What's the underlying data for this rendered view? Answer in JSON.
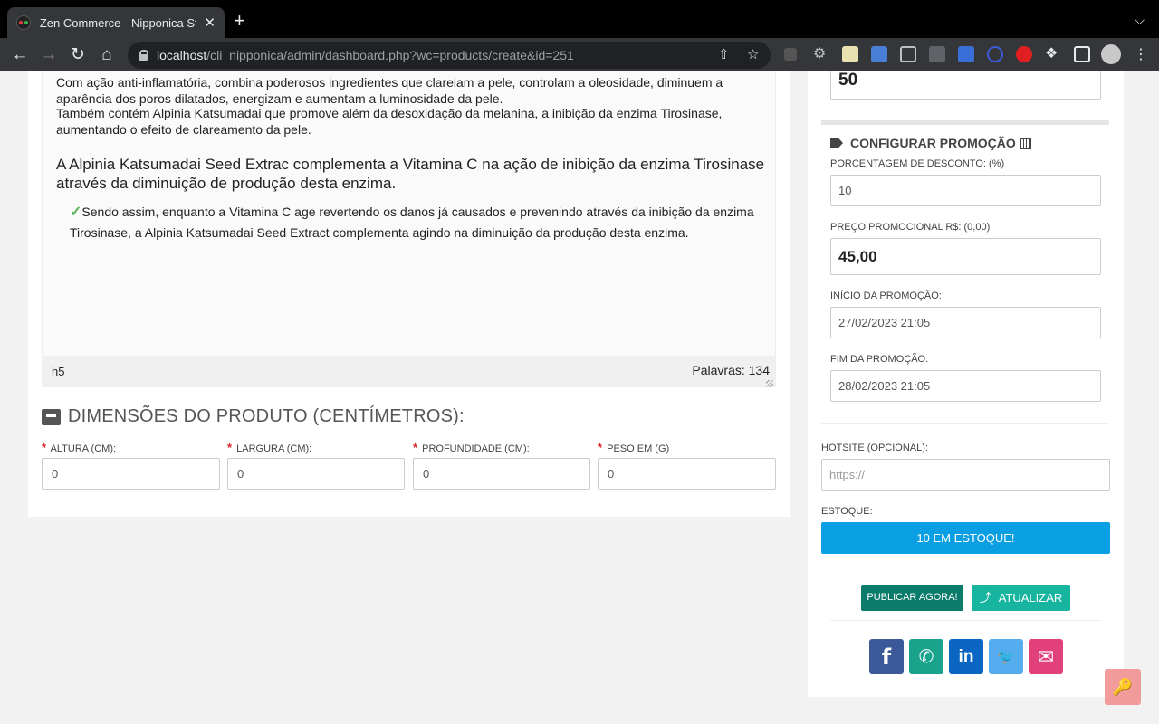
{
  "browser": {
    "tab_title": "Zen Commerce - Nipponica Store",
    "tab_close": "✕",
    "new_tab": "+",
    "url_host": "localhost",
    "url_path": "/cli_nipponica/admin/dashboard.php?wc=products/create&id=251"
  },
  "editor": {
    "paragraph1": "Com ação anti-inflamatória, combina poderosos ingredientes que clareiam a pele, controlam a oleosidade, diminuem a aparência dos poros dilatados, energizam e aumentam a luminosidade da pele.",
    "paragraph2": "Também contém Alpinia Katsumadai que promove além da desoxidação da melanina, a inibição da enzima Tirosinase, aumentando o efeito de clareamento da pele.",
    "heading": "A Alpinia Katsumadai Seed Extrac complementa a Vitamina C na ação de inibição da enzima Tirosinase através da diminuição de produção desta enzima.",
    "check_text": "Sendo assim, enquanto a Vitamina C age revertendo os danos já causados e prevenindo através da inibição da enzima Tirosinase, a Alpinia Katsumadai Seed Extract complementa agindo na diminuição da produção desta enzima.",
    "status_path": "h5",
    "word_count": "Palavras: 134"
  },
  "dimensions": {
    "title": "DIMENSÕES DO PRODUTO (CENTÍMETROS):",
    "height_label": "ALTURA (CM):",
    "height_value": "0",
    "width_label": "LARGURA (CM):",
    "width_value": "0",
    "depth_label": "PROFUNDIDADE (CM):",
    "depth_value": "0",
    "weight_label": "PESO EM (G)",
    "weight_value": "0",
    "required_mark": "*"
  },
  "sidebar": {
    "top_value": "50",
    "promo_title": "CONFIGURAR PROMOÇÃO",
    "discount_label": "PORCENTAGEM DE DESCONTO: (%)",
    "discount_value": "10",
    "promo_price_label": "PREÇO PROMOCIONAL R$: (0,00)",
    "promo_price_value": "45,00",
    "promo_start_label": "INÍCIO DA PROMOÇÃO:",
    "promo_start_value": "27/02/2023 21:05",
    "promo_end_label": "FIM DA PROMOÇÃO:",
    "promo_end_value": "28/02/2023 21:05",
    "hotsite_label": "HOTSITE (OPCIONAL):",
    "hotsite_placeholder": "https://",
    "stock_label": "ESTOQUE:",
    "stock_button": "10 EM ESTOQUE!",
    "publish_button": "PUBLICAR AGORA!",
    "update_button": "ATUALIZAR"
  },
  "colors": {
    "stock_button": "#0a9ee3",
    "publish_button": "#0a7a6a",
    "update_button": "#17b5a0",
    "facebook": "#3b5998",
    "whatsapp": "#1aa38c",
    "linkedin": "#0a66c2",
    "twitter": "#55acee",
    "email": "#e2407a"
  },
  "share": {
    "facebook_glyph": "f",
    "whatsapp_glyph": "✆",
    "linkedin_glyph": "in",
    "twitter_glyph": "🐦",
    "email_glyph": "✉"
  },
  "icons": {
    "key": "🔑"
  }
}
